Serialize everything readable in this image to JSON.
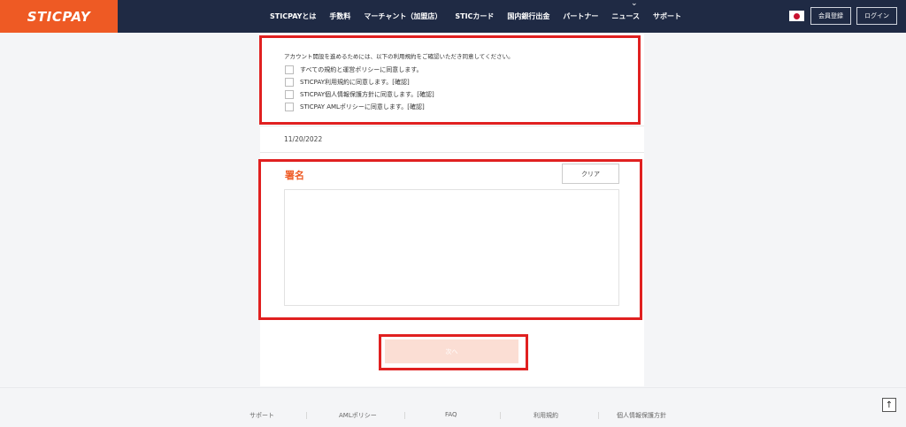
{
  "header": {
    "logo": "STICPAY",
    "nav": [
      "STICPAYとは",
      "手数料",
      "マーチャント（加盟店）",
      "STICカード",
      "国内銀行出金",
      "パートナー",
      "ニュース",
      "サポート"
    ],
    "signup_label": "会員登録",
    "login_label": "ログイン"
  },
  "terms": {
    "intro": "アカウント開設を進めるためには、以下の利用規約をご確認いただき同意してください。",
    "items": [
      "すべての規約と運営ポリシーに同意します。",
      "STICPAY利用規約に同意します。[確認]",
      "STICPAY個人情報保護方針に同意します。[確認]",
      "STICPAY AMLポリシーに同意します。[確認]"
    ]
  },
  "date": "11/20/2022",
  "signature": {
    "title": "署名",
    "clear_label": "クリア"
  },
  "next_label": "次へ",
  "footer": {
    "links": [
      "サポート",
      "AMLポリシー",
      "FAQ",
      "利用規約",
      "個人情報保護方針"
    ]
  },
  "colors": {
    "brand_orange": "#ee5a24",
    "header_navy": "#1f2a44",
    "highlight_red": "#e02020"
  }
}
